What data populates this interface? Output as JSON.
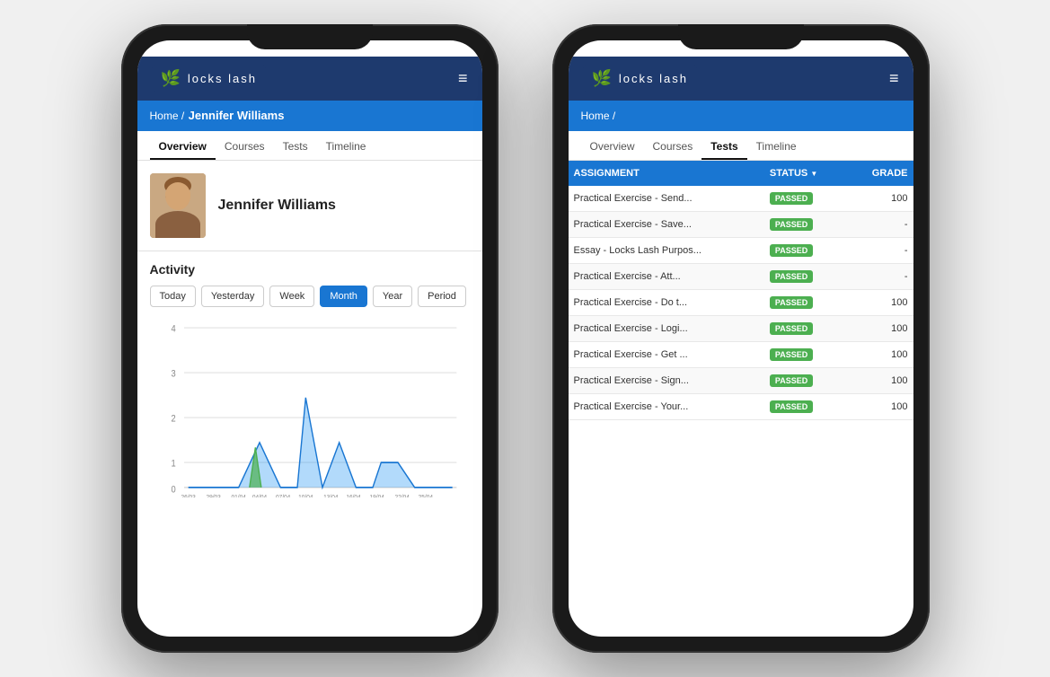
{
  "brand": {
    "name": "locks lash",
    "logo_symbol": "✿"
  },
  "phone1": {
    "breadcrumb": {
      "home": "Home /",
      "user": "Jennifer Williams"
    },
    "tabs": [
      "Overview",
      "Courses",
      "Tests",
      "Timeline"
    ],
    "active_tab": "Overview",
    "profile": {
      "name": "Jennifer Williams"
    },
    "activity": {
      "title": "Activity",
      "buttons": [
        "Today",
        "Yesterday",
        "Week",
        "Month",
        "Year",
        "Period"
      ],
      "active_button": "Month"
    },
    "chart": {
      "y_labels": [
        "4",
        "3",
        "2",
        "1",
        "0"
      ],
      "x_labels": [
        "26/03",
        "29/03",
        "01/04",
        "04/04",
        "07/04",
        "10/04",
        "13/04",
        "16/04",
        "19/04",
        "22/04",
        "25/04"
      ]
    }
  },
  "phone2": {
    "breadcrumb": {
      "home": "Home /"
    },
    "tabs": [
      "Overview",
      "Courses",
      "Tests",
      "Timeline"
    ],
    "active_tab": "Tests",
    "table": {
      "headers": [
        "ASSIGNMENT",
        "STATUS",
        "GRADE"
      ],
      "rows": [
        {
          "assignment": "Practical Exercise - Send...",
          "status": "PASSED",
          "grade": "100"
        },
        {
          "assignment": "Practical Exercise - Save...",
          "status": "PASSED",
          "grade": "-"
        },
        {
          "assignment": "Essay - Locks Lash Purpos...",
          "status": "PASSED",
          "grade": "-"
        },
        {
          "assignment": "Practical Exercise - Att...",
          "status": "PASSED",
          "grade": "-"
        },
        {
          "assignment": "Practical Exercise - Do t...",
          "status": "PASSED",
          "grade": "100"
        },
        {
          "assignment": "Practical Exercise - Logi...",
          "status": "PASSED",
          "grade": "100"
        },
        {
          "assignment": "Practical Exercise - Get ...",
          "status": "PASSED",
          "grade": "100"
        },
        {
          "assignment": "Practical Exercise - Sign...",
          "status": "PASSED",
          "grade": "100"
        },
        {
          "assignment": "Practical Exercise - Your...",
          "status": "PASSED",
          "grade": "100"
        }
      ]
    }
  },
  "colors": {
    "brand_blue": "#1e3a6e",
    "header_blue": "#1976d2",
    "passed_green": "#4caf50"
  }
}
